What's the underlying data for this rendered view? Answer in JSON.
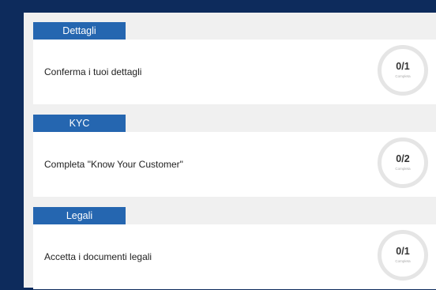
{
  "colors": {
    "background": "#0d2b5c",
    "panel": "#f0f0f0",
    "tab": "#2566b0",
    "card": "#ffffff",
    "ring": "#e5e5e5"
  },
  "sections": [
    {
      "tab_label": "Dettagli",
      "description": "Conferma i tuoi dettagli",
      "progress": "0/1",
      "progress_caption": "Completa"
    },
    {
      "tab_label": "KYC",
      "description": "Completa \"Know Your Customer\"",
      "progress": "0/2",
      "progress_caption": "Completa"
    },
    {
      "tab_label": "Legali",
      "description": "Accetta i documenti legali",
      "progress": "0/1",
      "progress_caption": "Completa"
    }
  ]
}
